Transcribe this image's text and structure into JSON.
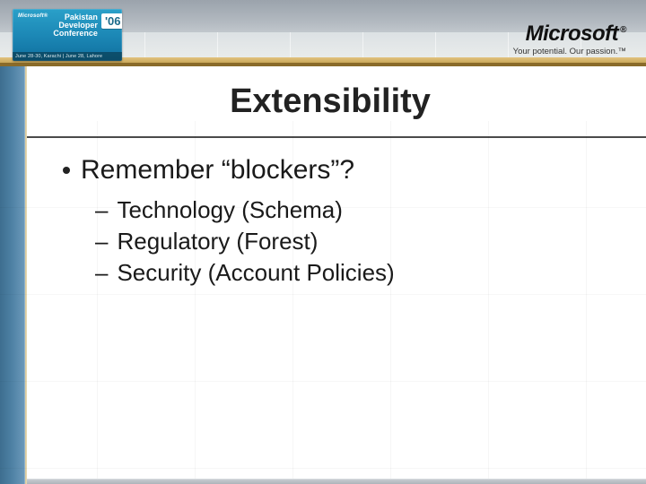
{
  "conference_badge": {
    "microsoft_mini": "Microsoft®",
    "line1": "Pakistan",
    "line2": "Developer",
    "line3": "Conference",
    "year_chip": "'06",
    "dates_line": "June 28-30, Karachi | June 28, Lahore"
  },
  "brand": {
    "logo_text": "Microsoft",
    "logo_reg": "®",
    "tagline": "Your potential. Our passion.™"
  },
  "slide": {
    "title": "Extensibility",
    "bullets_lvl1": [
      "Remember “blockers”?"
    ],
    "bullets_lvl2": [
      "Technology (Schema)",
      "Regulatory (Forest)",
      "Security (Account Policies)"
    ]
  }
}
